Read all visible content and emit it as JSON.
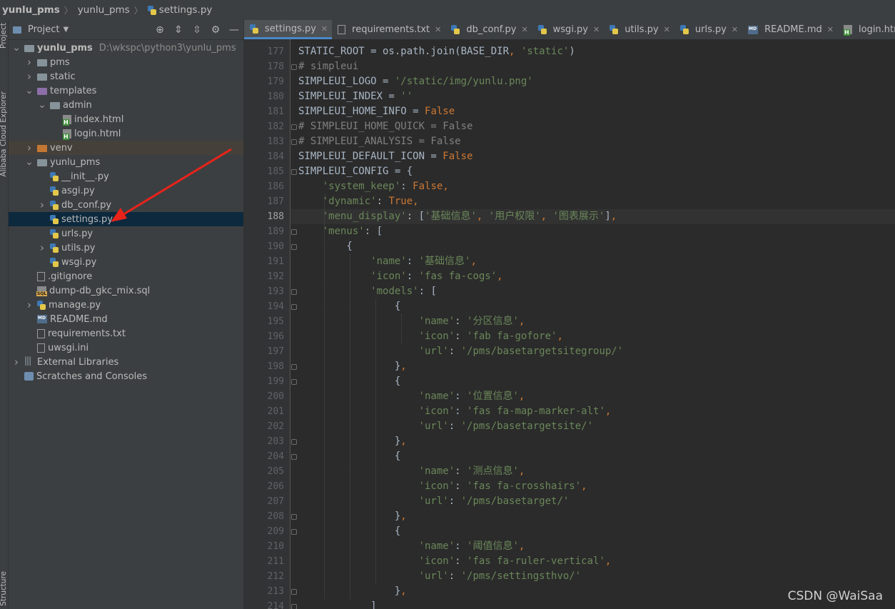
{
  "breadcrumb": [
    "yunlu_pms",
    "yunlu_pms",
    "settings.py"
  ],
  "side_tabs": {
    "project": "Project",
    "cloud": "Alibaba Cloud Explorer",
    "structure": "Structure"
  },
  "project_panel": {
    "title": "Project"
  },
  "tree": [
    {
      "label": "yunlu_pms",
      "path": "D:\\wkspc\\python3\\yunlu_pms",
      "depth": 0,
      "chevron": "down",
      "icon": "folder-icon",
      "bold": true
    },
    {
      "label": "pms",
      "depth": 1,
      "chevron": "right",
      "icon": "folder-icon"
    },
    {
      "label": "static",
      "depth": 1,
      "chevron": "right",
      "icon": "folder-icon"
    },
    {
      "label": "templates",
      "depth": 1,
      "chevron": "down",
      "icon": "templates-folder-icon"
    },
    {
      "label": "admin",
      "depth": 2,
      "chevron": "down",
      "icon": "folder-icon"
    },
    {
      "label": "index.html",
      "depth": 3,
      "chevron": "",
      "icon": "html-file-icon"
    },
    {
      "label": "login.html",
      "depth": 3,
      "chevron": "",
      "icon": "html-file-icon"
    },
    {
      "label": "venv",
      "depth": 1,
      "chevron": "right",
      "icon": "excluded-folder-icon"
    },
    {
      "label": "yunlu_pms",
      "depth": 1,
      "chevron": "down",
      "icon": "package-folder-icon"
    },
    {
      "label": "__init__.py",
      "depth": 2,
      "chevron": "",
      "icon": "python-file-icon"
    },
    {
      "label": "asgi.py",
      "depth": 2,
      "chevron": "",
      "icon": "python-file-icon"
    },
    {
      "label": "db_conf.py",
      "depth": 2,
      "chevron": "right",
      "icon": "python-file-icon"
    },
    {
      "label": "settings.py",
      "depth": 2,
      "chevron": "",
      "icon": "python-file-icon",
      "selected": true
    },
    {
      "label": "urls.py",
      "depth": 2,
      "chevron": "",
      "icon": "python-file-icon"
    },
    {
      "label": "utils.py",
      "depth": 2,
      "chevron": "right",
      "icon": "python-file-icon"
    },
    {
      "label": "wsgi.py",
      "depth": 2,
      "chevron": "",
      "icon": "python-file-icon"
    },
    {
      "label": ".gitignore",
      "depth": 1,
      "chevron": "",
      "icon": "text-file-icon"
    },
    {
      "label": "dump-db_gkc_mix.sql",
      "depth": 1,
      "chevron": "",
      "icon": "sql-file-icon"
    },
    {
      "label": "manage.py",
      "depth": 1,
      "chevron": "right",
      "icon": "python-file-icon"
    },
    {
      "label": "README.md",
      "depth": 1,
      "chevron": "",
      "icon": "markdown-file-icon"
    },
    {
      "label": "requirements.txt",
      "depth": 1,
      "chevron": "",
      "icon": "text-file-icon"
    },
    {
      "label": "uwsgi.ini",
      "depth": 1,
      "chevron": "",
      "icon": "ini-file-icon"
    },
    {
      "label": "External Libraries",
      "depth": 0,
      "chevron": "right",
      "icon": "library-icon"
    },
    {
      "label": "Scratches and Consoles",
      "depth": 0,
      "chevron": "",
      "icon": "scratches-icon"
    }
  ],
  "tabs": [
    {
      "label": "settings.py",
      "icon": "python-file-icon",
      "active": true
    },
    {
      "label": "requirements.txt",
      "icon": "text-file-icon"
    },
    {
      "label": "db_conf.py",
      "icon": "python-file-icon"
    },
    {
      "label": "wsgi.py",
      "icon": "python-file-icon"
    },
    {
      "label": "utils.py",
      "icon": "python-file-icon"
    },
    {
      "label": "urls.py",
      "icon": "python-file-icon"
    },
    {
      "label": "README.md",
      "icon": "markdown-file-icon"
    },
    {
      "label": "login.html",
      "icon": "html-file-icon"
    }
  ],
  "editor": {
    "current_line": 188,
    "lines": [
      {
        "n": 177,
        "text": "STATIC_ROOT = os.path.join(BASE_DIR, 'static')"
      },
      {
        "n": 178,
        "text": "# simpleui"
      },
      {
        "n": 179,
        "text": "SIMPLEUI_LOGO = '/static/img/yunlu.png'"
      },
      {
        "n": 180,
        "text": "SIMPLEUI_INDEX = ''"
      },
      {
        "n": 181,
        "text": "SIMPLEUI_HOME_INFO = False"
      },
      {
        "n": 182,
        "text": "# SIMPLEUI_HOME_QUICK = False"
      },
      {
        "n": 183,
        "text": "# SIMPLEUI_ANALYSIS = False"
      },
      {
        "n": 184,
        "text": "SIMPLEUI_DEFAULT_ICON = False"
      },
      {
        "n": 185,
        "text": "SIMPLEUI_CONFIG = {"
      },
      {
        "n": 186,
        "text": "    'system_keep': False,"
      },
      {
        "n": 187,
        "text": "    'dynamic': True,"
      },
      {
        "n": 188,
        "text": "    'menu_display': ['基础信息', '用户权限', '图表展示'],"
      },
      {
        "n": 189,
        "text": "    'menus': ["
      },
      {
        "n": 190,
        "text": "        {"
      },
      {
        "n": 191,
        "text": "            'name': '基础信息',"
      },
      {
        "n": 192,
        "text": "            'icon': 'fas fa-cogs',"
      },
      {
        "n": 193,
        "text": "            'models': ["
      },
      {
        "n": 194,
        "text": "                {"
      },
      {
        "n": 195,
        "text": "                    'name': '分区信息',"
      },
      {
        "n": 196,
        "text": "                    'icon': 'fab fa-gofore',"
      },
      {
        "n": 197,
        "text": "                    'url': '/pms/basetargetsitegroup/'"
      },
      {
        "n": 198,
        "text": "                },"
      },
      {
        "n": 199,
        "text": "                {"
      },
      {
        "n": 200,
        "text": "                    'name': '位置信息',"
      },
      {
        "n": 201,
        "text": "                    'icon': 'fas fa-map-marker-alt',"
      },
      {
        "n": 202,
        "text": "                    'url': '/pms/basetargetsite/'"
      },
      {
        "n": 203,
        "text": "                },"
      },
      {
        "n": 204,
        "text": "                {"
      },
      {
        "n": 205,
        "text": "                    'name': '测点信息',"
      },
      {
        "n": 206,
        "text": "                    'icon': 'fas fa-crosshairs',"
      },
      {
        "n": 207,
        "text": "                    'url': '/pms/basetarget/'"
      },
      {
        "n": 208,
        "text": "                },"
      },
      {
        "n": 209,
        "text": "                {"
      },
      {
        "n": 210,
        "text": "                    'name': '阈值信息',"
      },
      {
        "n": 211,
        "text": "                    'icon': 'fas fa-ruler-vertical',"
      },
      {
        "n": 212,
        "text": "                    'url': '/pms/settingsthvo/'"
      },
      {
        "n": 213,
        "text": "                },"
      },
      {
        "n": 214,
        "text": "            ]"
      }
    ]
  },
  "watermark": "CSDN @WaiSaa",
  "colors": {
    "accent": "#4a88c7",
    "selection": "#0d293e",
    "arrow": "#e8231a"
  }
}
